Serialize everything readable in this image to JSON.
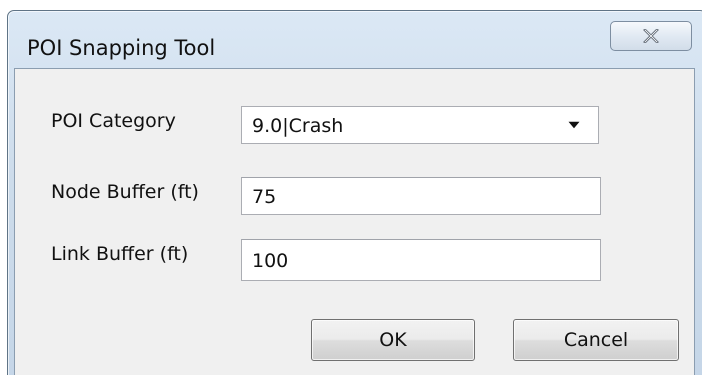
{
  "window": {
    "title": "POI Snapping Tool",
    "close_icon": "close-x-icon"
  },
  "form": {
    "poi_category": {
      "label": "POI Category",
      "selected": "9.0|Crash",
      "arrow_icon": "chevron-down-icon"
    },
    "node_buffer": {
      "label": "Node Buffer (ft)",
      "value": "75"
    },
    "link_buffer": {
      "label": "Link Buffer (ft)",
      "value": "100"
    }
  },
  "buttons": {
    "ok": "OK",
    "cancel": "Cancel"
  }
}
